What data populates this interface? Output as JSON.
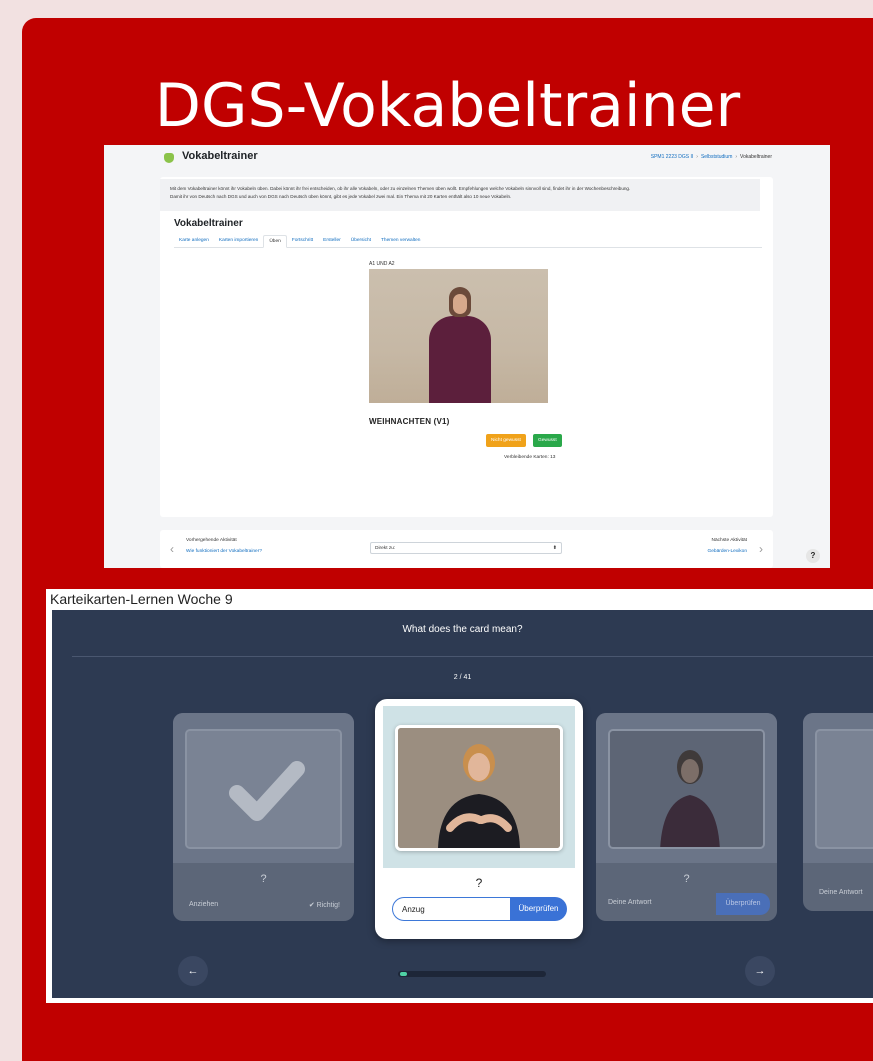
{
  "slide": {
    "title": "DGS-Vokabeltrainer"
  },
  "moodle": {
    "header_title": "Vokabeltrainer",
    "breadcrumb": [
      "SPM1 2223 DGS II",
      "Selbststudium",
      "Vokabeltrainer"
    ],
    "intro_line1": "Mit dem Vokabeltrainer könnt ihr Vokabeln üben. Dabei könnt ihr frei entscheiden, ob ihr alle Vokabeln, oder zu einzelnen Themen üben wollt. Empfehlungen welche Vokabeln sinnvoll sind, findet ihr in der Wochenbeschreibung.",
    "intro_line2": "Damit ihr von Deutsch nach DGS und auch von DGS nach Deutsch üben könnt, gibt es jede Vokabel zwei mal. Ein Thema mit 20 Karten enthält also 10 neue Vokabeln.",
    "heading": "Vokabeltrainer",
    "tabs": [
      "Karte anlegen",
      "Karten importieren",
      "Üben",
      "Fortschritt",
      "Ersteller",
      "Übersicht",
      "Themen verwalten"
    ],
    "active_tab": "Üben",
    "level": "A1 UND A2",
    "word": "WEIHNACHTEN (V1)",
    "btn_not_known": "Nicht gewusst",
    "btn_known": "Gewusst",
    "remaining": "Verbleibende Karten: 13",
    "prev_label": "Vorhergehende Aktivität",
    "prev_link": "Wie funktioniert der Vokabeltrainer?",
    "jump_label": "Direkt zu:",
    "next_label": "Nächste Aktivität",
    "next_link": "Gebärden-Lexikon",
    "help": "?"
  },
  "flashcards": {
    "heading": "Karteikarten-Lernen Woche 9",
    "question": "What does the card mean?",
    "counter": "2 / 41",
    "progress_fraction": 0.05,
    "left_card": {
      "qmark": "?",
      "answer": "Anziehen",
      "status": "✔ Richtig!"
    },
    "center_card": {
      "qmark": "?",
      "input_value": "Anzug",
      "check_label": "Überprüfen"
    },
    "right_card": {
      "qmark": "?",
      "placeholder": "Deine Antwort",
      "check_label": "Überprüfen"
    },
    "far_right_card": {
      "placeholder": "Deine Antwort"
    },
    "prev_icon": "arrow-left-icon",
    "next_icon": "arrow-right-icon"
  }
}
